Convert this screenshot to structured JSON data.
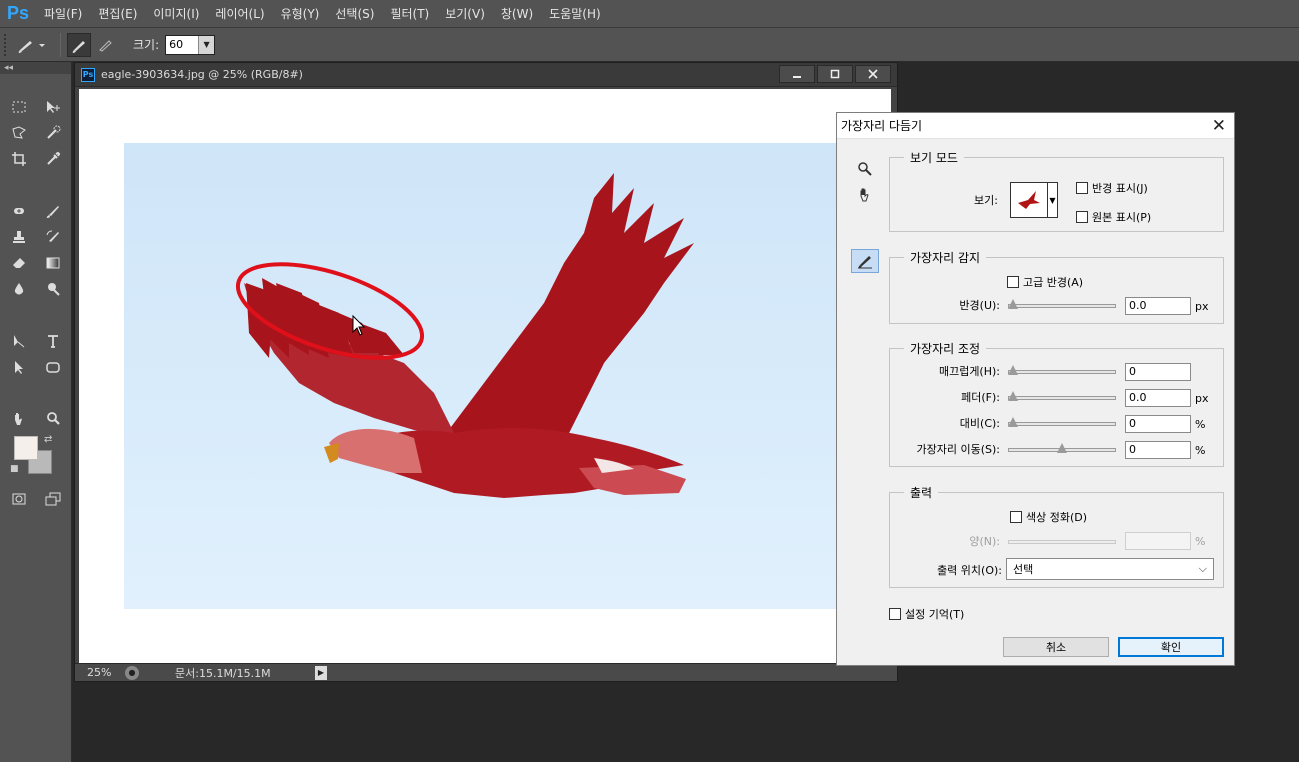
{
  "menubar": {
    "logo": "Ps",
    "items": [
      "파일(F)",
      "편집(E)",
      "이미지(I)",
      "레이어(L)",
      "유형(Y)",
      "선택(S)",
      "필터(T)",
      "보기(V)",
      "창(W)",
      "도움말(H)"
    ]
  },
  "options": {
    "size_label": "크기:",
    "size_value": "60"
  },
  "toolbar": {
    "collapse_glyph": "◂◂",
    "icons": [
      "rectangular-marquee-icon",
      "move-icon",
      "polygonal-lasso-icon",
      "quick-selection-icon",
      "crop-icon",
      "eyedropper-icon",
      "spot-healing-icon",
      "brush-icon",
      "clone-stamp-icon",
      "history-brush-icon",
      "eraser-icon",
      "gradient-icon",
      "blur-icon",
      "dodge-icon",
      "path-selection-icon",
      "type-icon",
      "direct-selection-icon",
      "rectangle-shape-icon",
      "hand-icon",
      "zoom-icon"
    ],
    "foreground_color": "#f4efea",
    "background_color": "#b9b9b9"
  },
  "document": {
    "title": "eagle-3903634.jpg @ 25% (RGB/8#)",
    "zoom": "25%",
    "doc_info": "문서:15.1M/15.1M",
    "accent_red": "#a8141c"
  },
  "dialog": {
    "title": "가장자리 다듬기",
    "view_mode": {
      "legend": "보기 모드",
      "view_label": "보기:",
      "show_radius": "반경 표시(J)",
      "show_original": "원본 표시(P)"
    },
    "edge_detection": {
      "legend": "가장자리 감지",
      "smart_radius": "고급 반경(A)",
      "radius_label": "반경(U):",
      "radius_value": "0.0",
      "radius_unit": "px"
    },
    "adjust_edge": {
      "legend": "가장자리 조정",
      "smooth_label": "매끄럽게(H):",
      "smooth_value": "0",
      "feather_label": "페더(F):",
      "feather_value": "0.0",
      "feather_unit": "px",
      "contrast_label": "대비(C):",
      "contrast_value": "0",
      "contrast_unit": "%",
      "shift_label": "가장자리 이동(S):",
      "shift_value": "0",
      "shift_unit": "%",
      "shift_level": 0.5
    },
    "output": {
      "legend": "출력",
      "decontaminate": "색상 정화(D)",
      "amount_label": "양(N):",
      "amount_unit": "%",
      "output_to_label": "출력 위치(O):",
      "output_to_value": "선택"
    },
    "remember": "설정 기억(T)",
    "cancel": "취소",
    "ok": "확인"
  }
}
